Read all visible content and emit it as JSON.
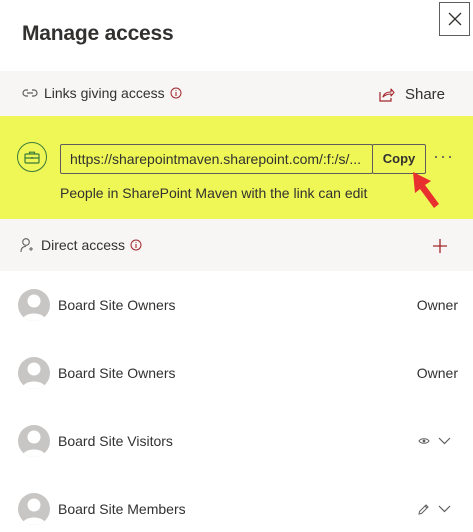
{
  "panel": {
    "title": "Manage access"
  },
  "links_section": {
    "heading": "Links giving access",
    "share_label": "Share",
    "link": {
      "url": "https://sharepointmaven.sharepoint.com/:f:/s/...",
      "copy_label": "Copy",
      "more_label": "···",
      "description": "People in SharePoint Maven with the link can edit"
    }
  },
  "direct_section": {
    "heading": "Direct access",
    "members": [
      {
        "name": "Board Site Owners",
        "role": "Owner"
      },
      {
        "name": "Board Site Owners",
        "role": "Owner"
      },
      {
        "name": "Board Site Visitors",
        "permission_icon": "eye-icon"
      },
      {
        "name": "Board Site Members",
        "permission_icon": "pencil-icon"
      }
    ]
  },
  "colors": {
    "highlight": "#eef755",
    "section_bg": "#f7f6f5",
    "arrow": "#e8302f",
    "link_icon": "#3b7a3b"
  }
}
